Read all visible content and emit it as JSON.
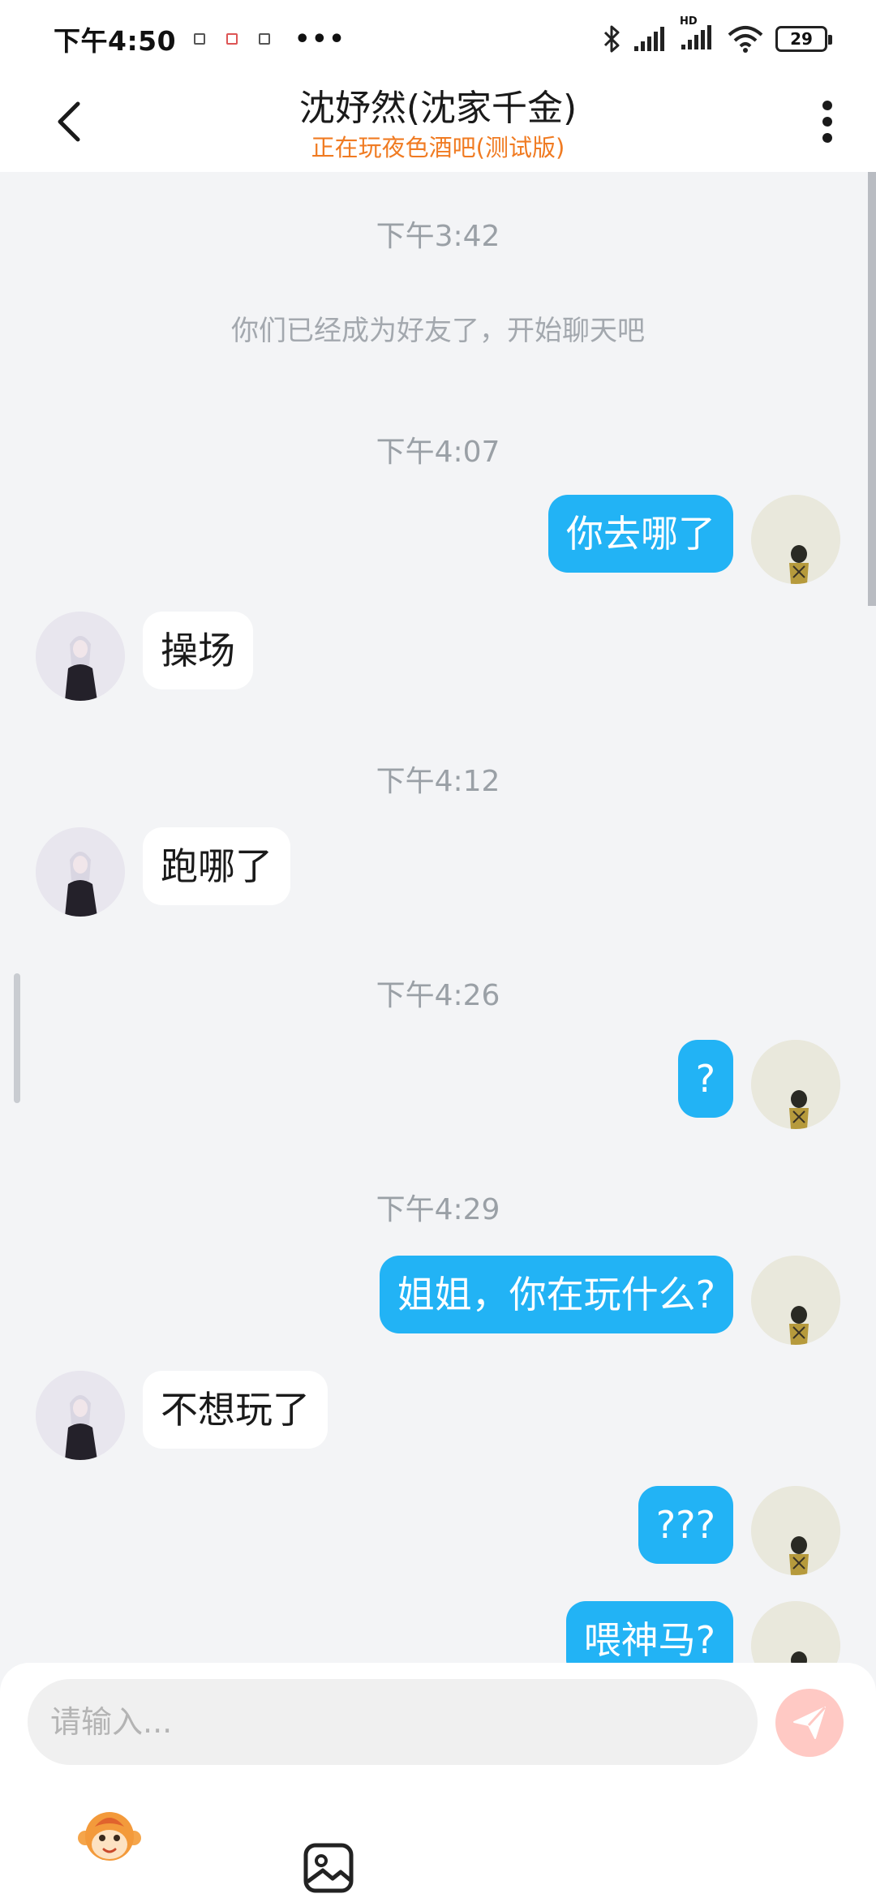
{
  "status_bar": {
    "time": "下午4:50",
    "more_dots": "•••",
    "battery": "29",
    "network_label": "HD"
  },
  "header": {
    "title": "沈妤然(沈家千金)",
    "subtitle": "正在玩夜色酒吧(测试版)"
  },
  "chat": {
    "items": [
      {
        "kind": "timestamp",
        "text": "下午3:42"
      },
      {
        "kind": "system",
        "text": "你们已经成为好友了，开始聊天吧"
      },
      {
        "kind": "timestamp",
        "text": "下午4:07"
      },
      {
        "kind": "message",
        "from": "me",
        "text": "你去哪了"
      },
      {
        "kind": "message",
        "from": "them",
        "text": "操场"
      },
      {
        "kind": "timestamp",
        "text": "下午4:12"
      },
      {
        "kind": "message",
        "from": "them",
        "text": "跑哪了"
      },
      {
        "kind": "timestamp",
        "text": "下午4:26"
      },
      {
        "kind": "message",
        "from": "me",
        "text": "?"
      },
      {
        "kind": "timestamp",
        "text": "下午4:29"
      },
      {
        "kind": "message",
        "from": "me",
        "text": "姐姐，你在玩什么?"
      },
      {
        "kind": "message",
        "from": "them",
        "text": "不想玩了"
      },
      {
        "kind": "message",
        "from": "me",
        "text": "???"
      },
      {
        "kind": "message",
        "from": "me",
        "text": "喂神马?"
      }
    ]
  },
  "input": {
    "placeholder": "请输入..."
  },
  "icons": {
    "back": "chevron-left-icon",
    "more": "more-vertical-icon",
    "send": "paper-plane-icon",
    "emoji": "monkey-emoji-icon",
    "image": "image-icon",
    "bluetooth": "bluetooth-icon",
    "signal": "signal-icon",
    "wifi": "wifi-icon"
  },
  "colors": {
    "accent_orange": "#f07b22",
    "bubble_me": "#22b3f5",
    "bubble_them": "#ffffff",
    "send_disabled": "#ffc9c4"
  }
}
